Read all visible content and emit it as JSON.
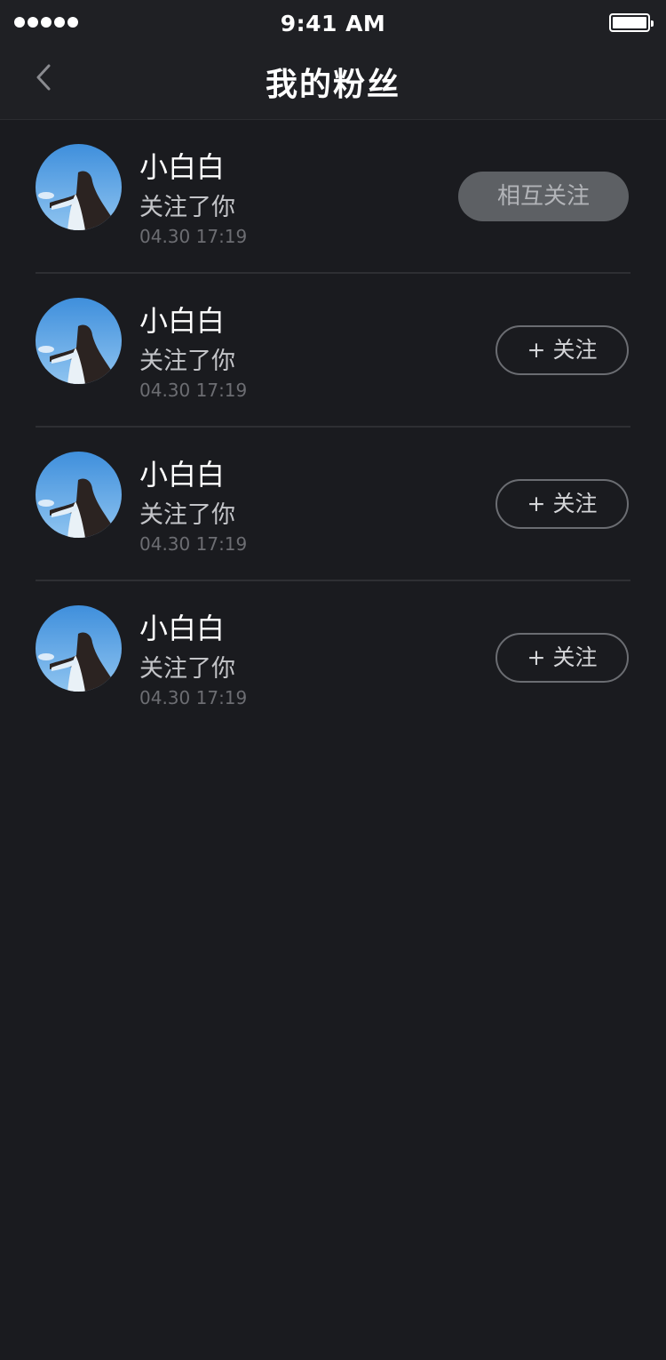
{
  "status_bar": {
    "time": "9:41 AM",
    "signal_icon": "signal-dots-icon",
    "battery_icon": "battery-full-icon"
  },
  "nav": {
    "title": "我的粉丝",
    "back_icon": "chevron-left-icon"
  },
  "fans": [
    {
      "name": "小白白",
      "action": "关注了你",
      "time": "04.30 17:19",
      "button_label": "相互关注",
      "button_type": "mutual"
    },
    {
      "name": "小白白",
      "action": "关注了你",
      "time": "04.30 17:19",
      "button_label": "+ 关注",
      "button_type": "follow"
    },
    {
      "name": "小白白",
      "action": "关注了你",
      "time": "04.30 17:19",
      "button_label": "+ 关注",
      "button_type": "follow"
    },
    {
      "name": "小白白",
      "action": "关注了你",
      "time": "04.30 17:19",
      "button_label": "+ 关注",
      "button_type": "follow"
    }
  ],
  "colors": {
    "background": "#1a1b1f",
    "bar_background": "#1f2024",
    "divider": "#2e2f33",
    "mutual_button_bg": "#5d6064",
    "follow_button_border": "#6b6d72"
  }
}
